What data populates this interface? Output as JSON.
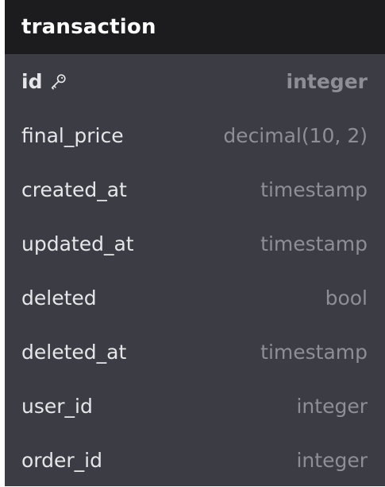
{
  "table": {
    "name": "transaction",
    "columns": [
      {
        "name": "id",
        "type": "integer",
        "primary_key": true,
        "icon": "key-icon"
      },
      {
        "name": "final_price",
        "type": "decimal(10, 2)",
        "primary_key": false
      },
      {
        "name": "created_at",
        "type": "timestamp",
        "primary_key": false
      },
      {
        "name": "updated_at",
        "type": "timestamp",
        "primary_key": false
      },
      {
        "name": "deleted",
        "type": "bool",
        "primary_key": false
      },
      {
        "name": "deleted_at",
        "type": "timestamp",
        "primary_key": false
      },
      {
        "name": "user_id",
        "type": "integer",
        "primary_key": false
      },
      {
        "name": "order_id",
        "type": "integer",
        "primary_key": false
      }
    ]
  },
  "colors": {
    "header_bg": "#1c1c1e",
    "body_bg": "#3b3c44",
    "name_text": "#e6e6ea",
    "type_text": "#8e8f96"
  }
}
